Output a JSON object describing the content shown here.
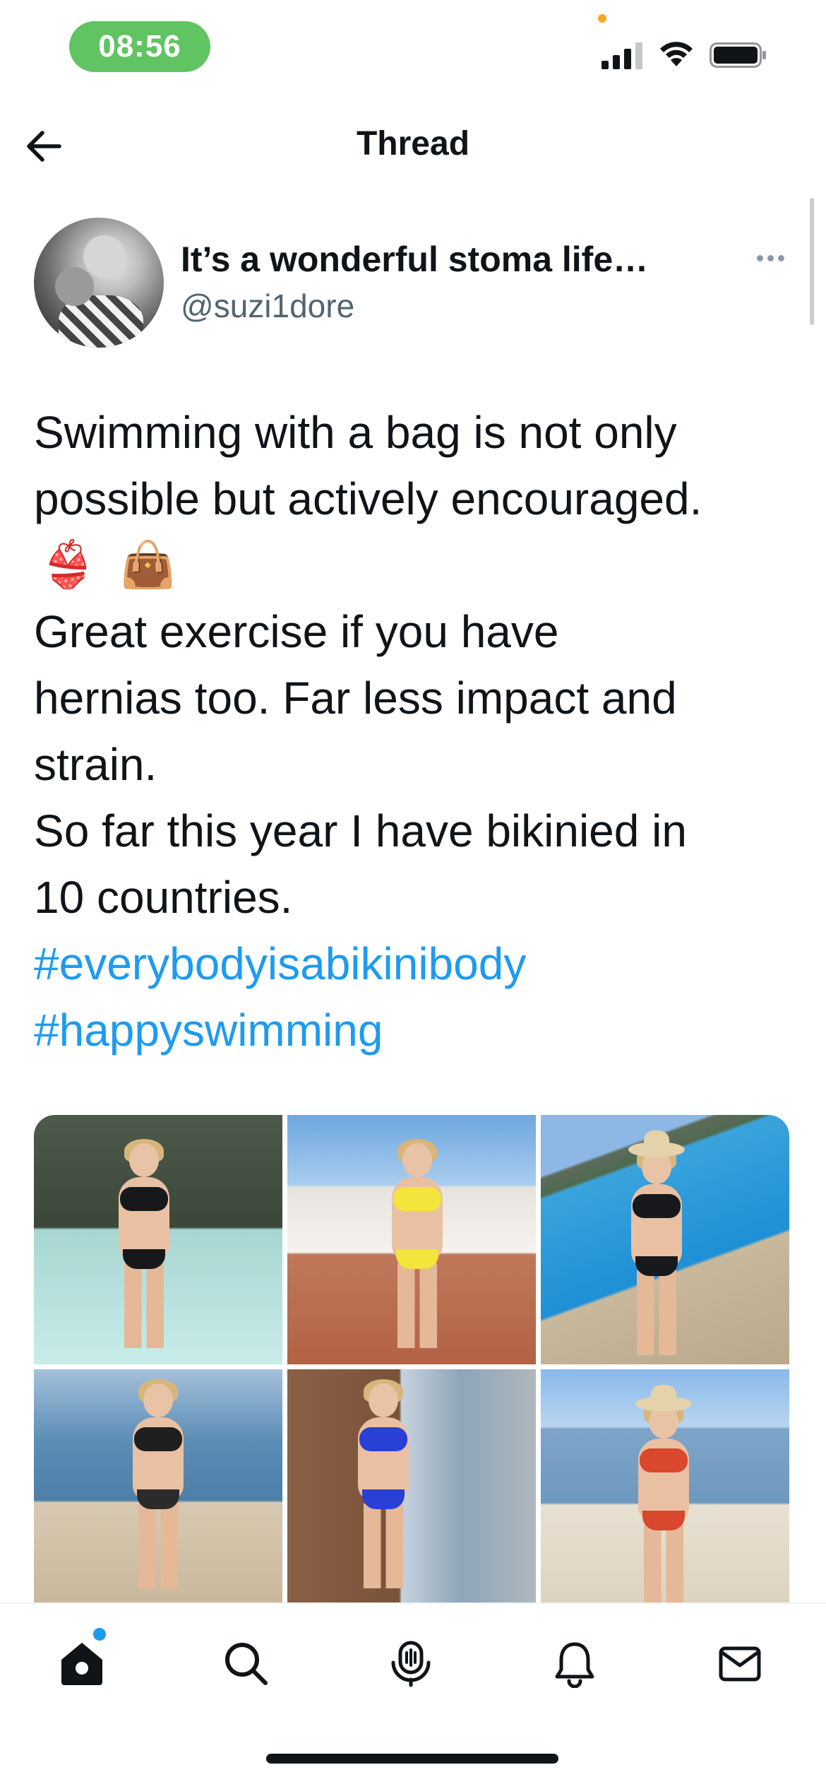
{
  "status_bar": {
    "time": "08:56",
    "icons": [
      "signal-icon",
      "wifi-icon",
      "battery-icon"
    ]
  },
  "header": {
    "title": "Thread",
    "back_icon": "arrow-left-icon"
  },
  "tweet": {
    "author_name": "It’s a wonderful stoma life…",
    "author_handle": "@suzi1dore",
    "text_lines": [
      "Swimming with a bag is not only",
      "possible but actively encouraged."
    ],
    "emojis": [
      "👙",
      "👜"
    ],
    "text_lines_after": [
      "Great exercise if you have",
      "hernias too. Far less impact and",
      "strain.",
      "So far this year I have bikinied in",
      "10 countries."
    ],
    "hashtags": [
      "#everybodyisabikinibody",
      "#happyswimming"
    ],
    "photos": [
      {
        "scene": "geothermal-lagoon",
        "swimwear_color": "#16181b"
      },
      {
        "scene": "hotel-terrace",
        "swimwear_color": "#f3e53b"
      },
      {
        "scene": "resort-pool",
        "swimwear_color": "#18191c"
      },
      {
        "scene": "lake-shore",
        "swimwear_color": "#1f1f1f"
      },
      {
        "scene": "balcony",
        "swimwear_color": "#2840d4"
      },
      {
        "scene": "sandy-beach",
        "swimwear_color": "#d9472c"
      }
    ]
  },
  "tab_bar": {
    "items": [
      "home-icon",
      "search-icon",
      "spaces-icon",
      "notifications-icon",
      "messages-icon"
    ],
    "active": "home-icon",
    "accent": "#1d9bf0"
  },
  "colors": {
    "text_primary": "#0f1419",
    "text_secondary": "#536471",
    "link": "#1d9bf0",
    "time_pill": "#5fc461"
  }
}
